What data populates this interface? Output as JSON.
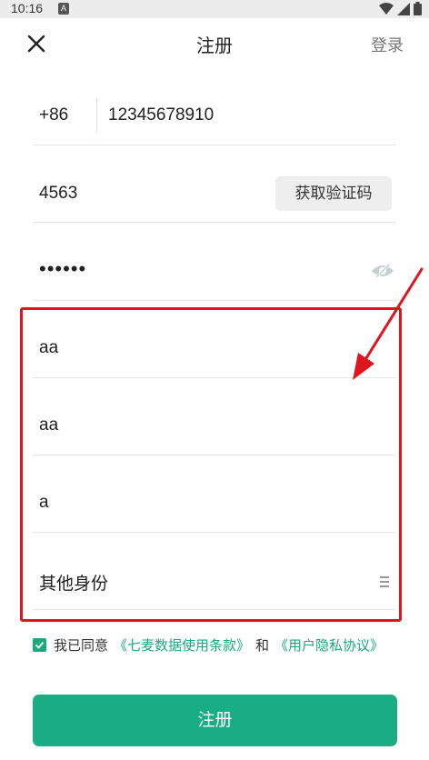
{
  "status_bar": {
    "time": "10:16",
    "notification_glyph": "A"
  },
  "nav": {
    "title": "注册",
    "login_label": "登录"
  },
  "form": {
    "country_code": "+86",
    "phone": "12345678910",
    "verification_code": "4563",
    "get_code_label": "获取验证码",
    "password_masked": "••••••",
    "field_1": "aa",
    "field_2": "aa",
    "field_3": "a",
    "identity": "其他身份"
  },
  "agreement": {
    "prefix": "我已同意",
    "terms_link": "《七麦数据使用条款》",
    "and": "和",
    "privacy_link": "《用户隐私协议》"
  },
  "submit_label": "注册",
  "colors": {
    "accent": "#18ad83",
    "highlight": "#e0141e"
  }
}
